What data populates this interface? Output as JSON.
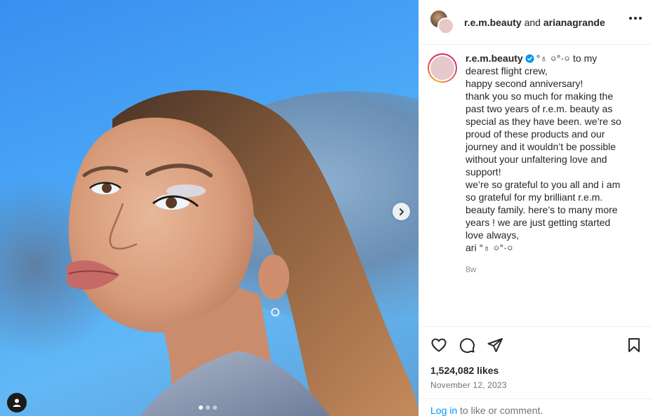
{
  "media": {
    "slide_count": 3,
    "active_slide": 1,
    "next_icon": "chevron-right-icon",
    "tag_icon": "user-icon"
  },
  "header": {
    "author": "r.e.m.beauty",
    "connector": "and",
    "collaborator": "arianagrande",
    "more_icon": "more-horizontal-icon"
  },
  "caption": {
    "username": "r.e.m.beauty",
    "lines": [
      "°♁ ০°·০ to my",
      "dearest flight crew,",
      "happy second anniversary!",
      "thank you so much for making the",
      "past two years of r.e.m. beauty as",
      "special as they have been. we’re so",
      "proud of these products and our",
      "journey and it wouldn’t be possible",
      "without your unfaltering love and",
      "support!",
      "we’re so grateful to you all and i am",
      "so grateful for my brilliant r.e.m.",
      "beauty family. here’s to many more",
      "years ! we are just getting started",
      "love always,",
      "ari °♁ ০°·০"
    ],
    "time": "8w"
  },
  "actions": {
    "like_icon": "heart-icon",
    "comment_icon": "comment-icon",
    "share_icon": "share-icon",
    "save_icon": "bookmark-icon"
  },
  "likes": "1,524,082 likes",
  "date": "November 12, 2023",
  "login": {
    "link": "Log in",
    "rest": " to like or comment."
  },
  "colors": {
    "link": "#0095f6",
    "verified": "#0095f6",
    "muted": "#737373"
  }
}
